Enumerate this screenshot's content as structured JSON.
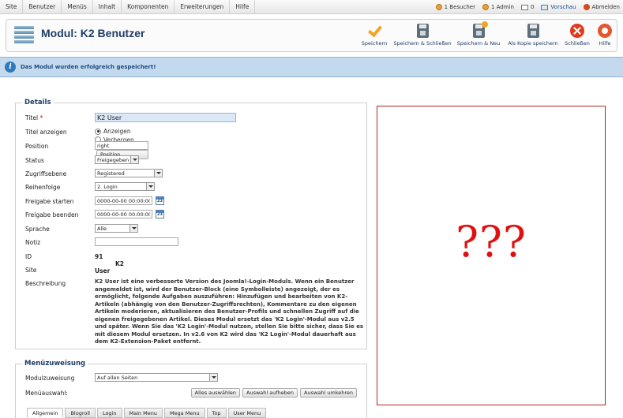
{
  "menu": [
    "Site",
    "Benutzer",
    "Menüs",
    "Inhalt",
    "Komponenten",
    "Erweiterungen",
    "Hilfe"
  ],
  "status": {
    "visitors": "1 Besucher",
    "admins": "1 Admin",
    "messages": "0",
    "preview": "Vorschau",
    "logout": "Abmelden"
  },
  "page": {
    "title": "Modul: K2 Benutzer"
  },
  "toolbar": {
    "save": "Speichern",
    "save_close": "Speichern & Schließen",
    "save_new": "Speichern & Neu",
    "save_copy": "Als Kopie speichern",
    "close": "Schließen",
    "help": "Hilfe"
  },
  "message": "Das Modul wurden erfolgreich gespeichert!",
  "details": {
    "legend": "Details",
    "title_label": "Titel",
    "title_value": "K2 User",
    "show_title_label": "Titel anzeigen",
    "show_title_on": "Anzeigen",
    "show_title_off": "Verbergen",
    "position_label": "Position",
    "position_value": "right",
    "position_button": "Position auswählen",
    "status_label": "Status",
    "status_value": "Freigegeben",
    "access_label": "Zugriffsebene",
    "access_value": "Registered",
    "order_label": "Reihenfolge",
    "order_value": "2. Login",
    "publish_up_label": "Freigabe starten",
    "publish_up_value": "0000-00-00 00:00:00",
    "publish_down_label": "Freigabe beenden",
    "publish_down_value": "0000-00-00 00:00:00",
    "calendar_day": "23",
    "language_label": "Sprache",
    "language_value": "Alle",
    "note_label": "Notiz",
    "note_value": "",
    "id_label": "ID",
    "id_value": "91",
    "id_name": "K2 User",
    "site_label": "Site",
    "description_label": "Beschreibung",
    "description": "K2 User ist eine verbesserte Version des Joomla!-Login-Moduls. Wenn ein Benutzer angemeldet ist, wird der Benutzer-Block (eine Symbolleiste) angezeigt, der es ermöglicht, folgende Aufgaben auszuführen: Hinzufügen und bearbeiten von K2-Artikeln (abhängig von den Benutzer-Zugriffsrechten), Kommentare zu den eigenen Artikeln moderieren, aktualisieren des Benutzer-Profils und schnellen Zugriff auf die eigenen freigegebenen Artikel. Dieses Modul ersetzt das 'K2 Login'-Modul aus v2.5 und später. Wenn Sie das 'K2 Login'-Modul nutzen, stellen Sie bitte sicher, dass Sie es mit diesem Modul ersetzen. In v2.6 von K2 wird das 'K2 Login'-Modul dauerhaft aus dem K2-Extension-Paket entfernt."
  },
  "menu_assignment": {
    "legend": "Menüzuweisung",
    "assignment_label": "Modulzuweisung",
    "assignment_value": "Auf allen Seiten",
    "selection_label": "Menüauswahl:",
    "select_all": "Alles auswählen",
    "deselect": "Auswahl aufheben",
    "invert": "Auswahl umkehren",
    "tabs": [
      "Allgemein",
      "Blogroll",
      "Login",
      "Main Menu",
      "Mega Menu",
      "Top",
      "User Menu"
    ]
  },
  "preview": {
    "text": "???"
  },
  "colors": {
    "accent": "#1f3d66",
    "message_bg": "#c3d9ee",
    "preview_border": "#b22222",
    "question_marks": "#e01010"
  }
}
